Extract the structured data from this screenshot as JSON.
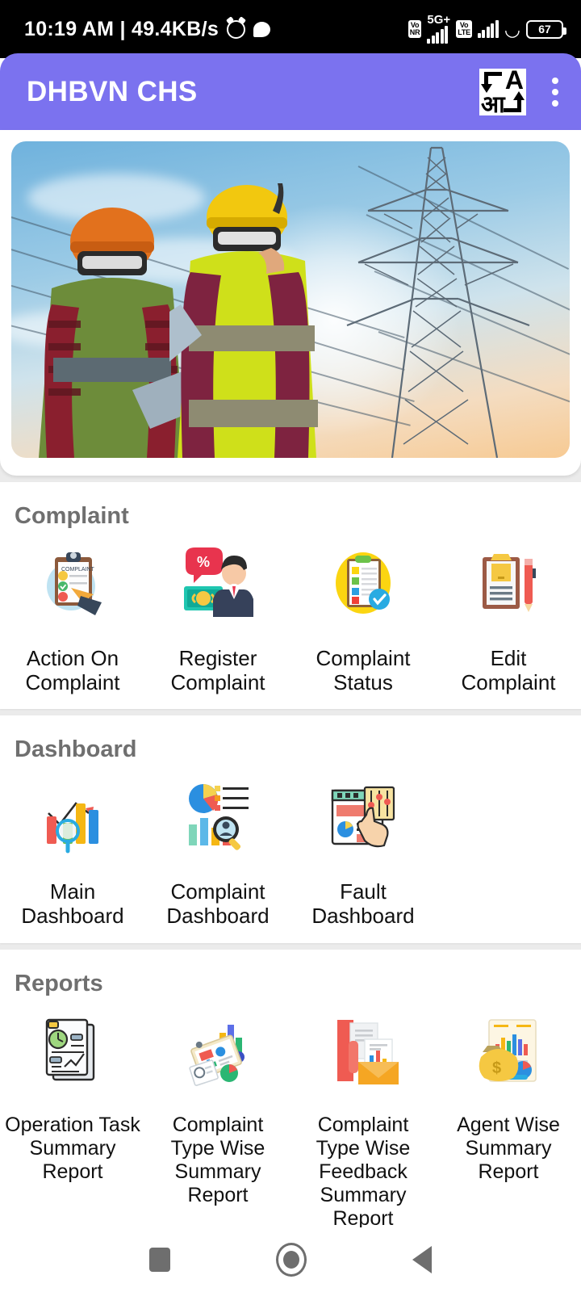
{
  "status_bar": {
    "time_and_speed": "10:19 AM | 49.4KB/s",
    "alarm_icon": "alarm-icon",
    "chat_icon": "chat-bubble-icon",
    "volte_nr_label": "Vo\nNR",
    "network_type": "5G+",
    "volte_label": "Vo\nLTE",
    "rotation_icon": "rotation-lock-icon",
    "battery_level": "67"
  },
  "app_bar": {
    "title": "DHBVN CHS",
    "translate_icon": {
      "latin": "A",
      "devanagari": "आ"
    },
    "overflow_menu": "more-options"
  },
  "banner": {
    "alt": "Two electrical linemen in hard hats and hi-vis vests looking up at a high-voltage transmission tower"
  },
  "sections": [
    {
      "title": "Complaint",
      "items": [
        {
          "label": "Action On Complaint",
          "icon": "clipboard-complaint-icon"
        },
        {
          "label": "Register Complaint",
          "icon": "agent-money-icon"
        },
        {
          "label": "Complaint Status",
          "icon": "checklist-status-icon"
        },
        {
          "label": "Edit Complaint",
          "icon": "clipboard-pencil-icon"
        }
      ]
    },
    {
      "title": "Dashboard",
      "items": [
        {
          "label": "Main Dashboard",
          "icon": "bar-chart-search-icon"
        },
        {
          "label": "Complaint Dashboard",
          "icon": "analytics-person-search-icon"
        },
        {
          "label": "Fault Dashboard",
          "icon": "dashboard-panel-hand-icon"
        }
      ]
    },
    {
      "title": "Reports",
      "items": [
        {
          "label": "Operation Task Summary Report",
          "icon": "document-gauge-icon"
        },
        {
          "label": "Complaint Type Wise Summary Report",
          "icon": "clipboard-charts-icon"
        },
        {
          "label": "Complaint Type Wise Feedback Summary Report",
          "icon": "envelope-report-icon"
        },
        {
          "label": "Agent Wise Summary Report",
          "icon": "money-bag-charts-icon"
        }
      ]
    }
  ],
  "nav_bar": {
    "recents": "recents-button",
    "home": "home-button",
    "back": "back-button"
  },
  "colors": {
    "app_bar_purple": "#7b72ef",
    "page_background": "#ebebeb",
    "section_title_gray": "#6f6f6f",
    "status_bar_black": "#000000"
  }
}
